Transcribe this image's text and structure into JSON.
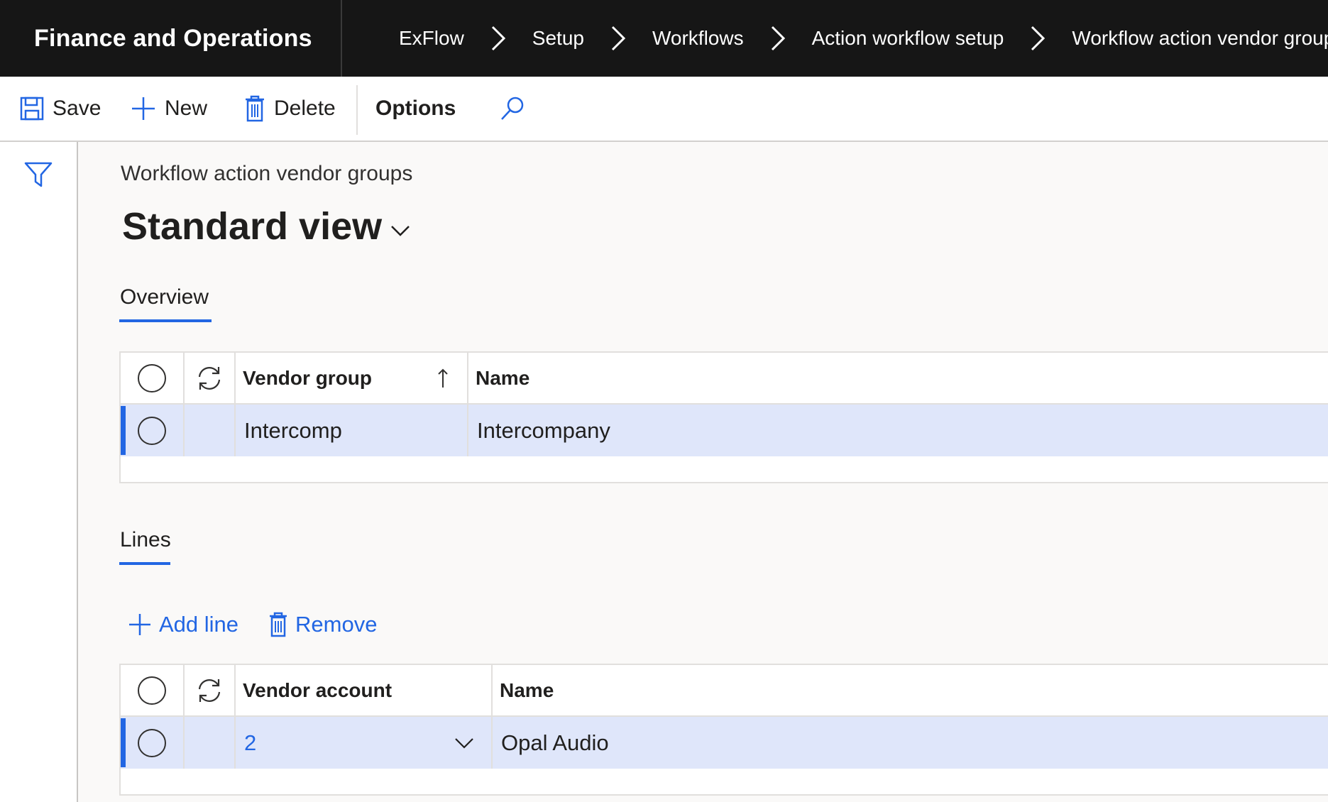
{
  "app": {
    "title": "Finance and Operations"
  },
  "breadcrumb": [
    "ExFlow",
    "Setup",
    "Workflows",
    "Action workflow setup",
    "Workflow action vendor groups"
  ],
  "toolbar": {
    "save": "Save",
    "new": "New",
    "delete": "Delete",
    "options": "Options"
  },
  "page": {
    "caption": "Workflow action vendor groups",
    "view": "Standard view"
  },
  "overview": {
    "tab": "Overview",
    "columns": [
      "Vendor group",
      "Name"
    ],
    "rows": [
      {
        "vendor_group": "Intercomp",
        "name": "Intercompany"
      }
    ]
  },
  "lines": {
    "tab": "Lines",
    "add_line": "Add line",
    "remove": "Remove",
    "columns": [
      "Vendor account",
      "Name"
    ],
    "rows": [
      {
        "vendor_account": "2",
        "name": "Opal Audio"
      }
    ]
  },
  "colors": {
    "accent": "#2266e3",
    "topbar": "#161616",
    "selected_row": "#dfe6fa"
  },
  "icons": [
    "save-icon",
    "plus-icon",
    "trash-icon",
    "search-icon",
    "filter-icon",
    "chevron-right-icon",
    "chevron-down-icon",
    "refresh-icon",
    "sort-ascending-icon"
  ]
}
